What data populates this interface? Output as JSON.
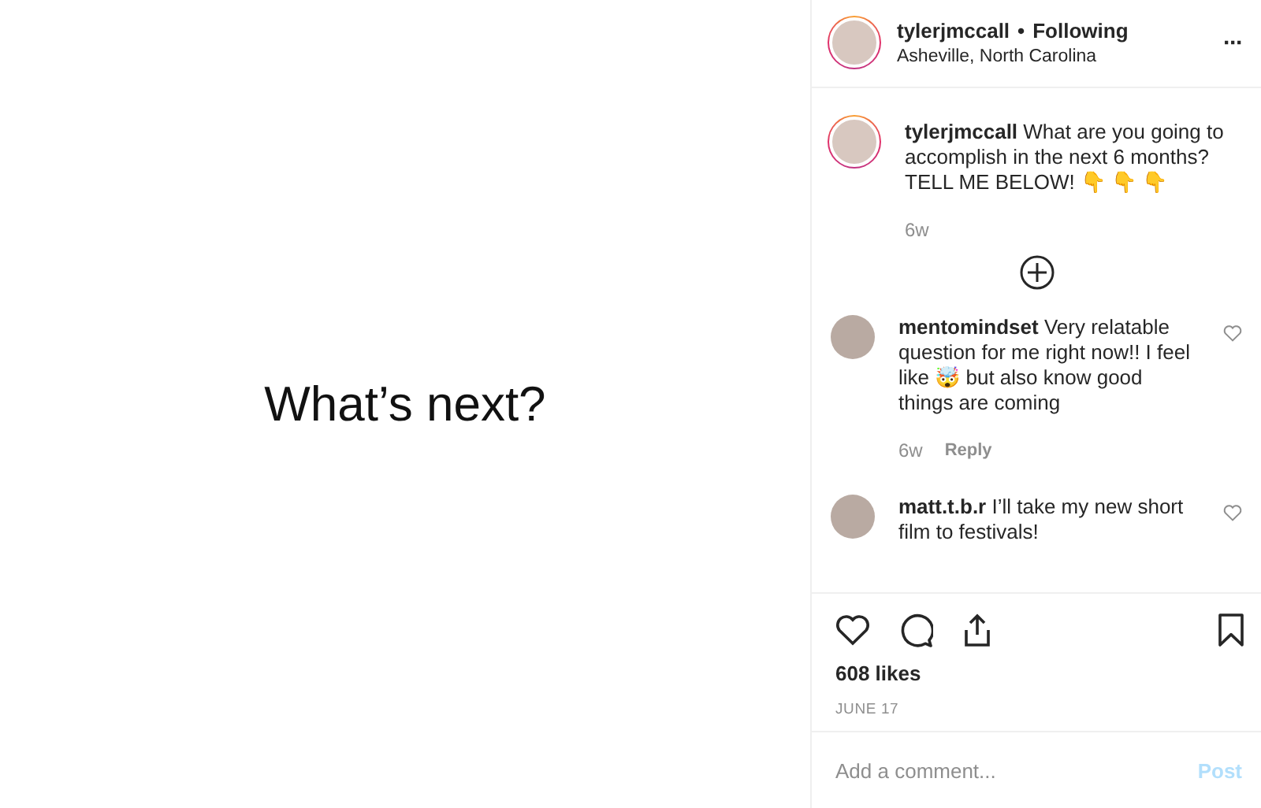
{
  "image": {
    "caption": "What’s next?"
  },
  "header": {
    "username": "tylerjmccall",
    "separator": "•",
    "follow": "Following",
    "location": "Asheville, North Carolina",
    "more": "···"
  },
  "caption": {
    "username": "tylerjmccall",
    "text": "What are you going to accomplish in the next 6 months? TELL ME BELOW! 👇 👇 👇",
    "time": "6w"
  },
  "comments": [
    {
      "username": "mentomindset",
      "text": "Very relatable question for me right now!! I feel like 🤯 but also know good things are coming",
      "time": "6w",
      "reply": "Reply",
      "liked": false
    },
    {
      "username": "matt.t.b.r",
      "text": "I’ll take my new short film to festivals!",
      "liked": false
    }
  ],
  "likes": "608 likes",
  "date": "JUNE 17",
  "comment_box": {
    "placeholder": "Add a comment...",
    "post": "Post"
  }
}
